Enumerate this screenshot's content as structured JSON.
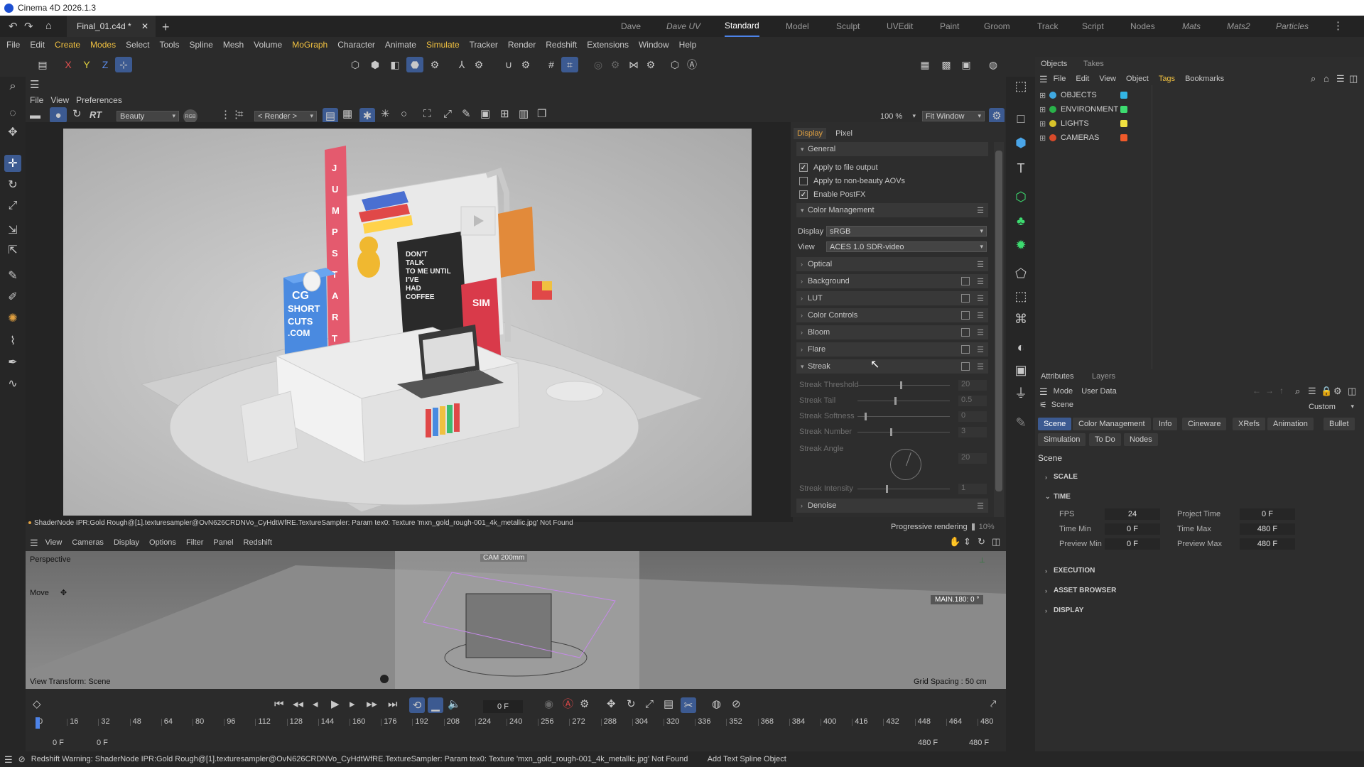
{
  "window": {
    "title": "Cinema 4D 2026.1.3"
  },
  "tabbar": {
    "doc_tab": "Final_01.c4d *",
    "layouts": [
      "Dave",
      "Dave UV",
      "Standard",
      "Model",
      "Sculpt",
      "UVEdit",
      "Paint",
      "Groom",
      "Track",
      "Script",
      "Nodes",
      "Mats",
      "Mats2",
      "Particles"
    ],
    "active_layout": "Standard"
  },
  "menubar": {
    "items": [
      "File",
      "Edit",
      "Create",
      "Modes",
      "Select",
      "Tools",
      "Spline",
      "Mesh",
      "Volume",
      "MoGraph",
      "Character",
      "Animate",
      "Simulate",
      "Tracker",
      "Render",
      "Redshift",
      "Extensions",
      "Window",
      "Help"
    ]
  },
  "toolbar": {
    "axis_x": "X",
    "axis_y": "Y",
    "axis_z": "Z"
  },
  "viewport": {
    "menu": [
      "File",
      "View",
      "Preferences"
    ],
    "aov": "Beauty",
    "rgb": "RGB",
    "render_mode": "< Render >",
    "rt": "RT",
    "zoom": "100 %",
    "fit": "Fit Window",
    "warning": "ShaderNode IPR:Gold Rough@[1].texturesampler@OvN626CRDNVo_CyHdtWfRE.TextureSampler: Param tex0: Texture 'mxn_gold_rough-001_4k_metallic.jpg' Not Found",
    "progressive_label": "Progressive rendering",
    "progress_pct": "10%",
    "progress": 0.1
  },
  "render_scene": {
    "sign_letters": [
      "J",
      "U",
      "M",
      "P",
      "S",
      "T",
      "A",
      "R",
      "T"
    ],
    "box_text": [
      "CG",
      "SHORT",
      "CUTS",
      ".COM"
    ],
    "poster_text": [
      "DON'T",
      "TALK",
      "TO ME UNTIL",
      "I'VE",
      "HAD",
      "COFFEE"
    ],
    "sim_text": "SIM"
  },
  "settings": {
    "tabs": [
      "Display",
      "Pixel"
    ],
    "sections": {
      "general": "General",
      "apply_file": "Apply to file output",
      "apply_aov": "Apply to non-beauty AOVs",
      "enable_postfx": "Enable PostFX",
      "color_mgmt": "Color Management",
      "display_label": "Display",
      "display_value": "sRGB",
      "view_label": "View",
      "view_value": "ACES 1.0 SDR-video",
      "optical": "Optical",
      "background": "Background",
      "lut": "LUT",
      "color_controls": "Color Controls",
      "bloom": "Bloom",
      "flare": "Flare",
      "streak": "Streak",
      "denoise": "Denoise"
    },
    "streak": {
      "threshold_label": "Streak Threshold",
      "threshold": "20",
      "tail_label": "Streak Tail",
      "tail": "0.5",
      "softness_label": "Streak Softness",
      "softness": "0",
      "number_label": "Streak Number",
      "number": "3",
      "angle_label": "Streak Angle",
      "angle": "20",
      "intensity_label": "Streak Intensity",
      "intensity": "1"
    }
  },
  "lower_viewport": {
    "menu": [
      "View",
      "Cameras",
      "Display",
      "Options",
      "Filter",
      "Panel",
      "Redshift"
    ],
    "label": "Perspective",
    "move": "Move",
    "cam": "CAM 200mm",
    "main": "MAIN.180:  0 °",
    "view_transform": "View Transform: Scene",
    "grid": "Grid Spacing : 50 cm"
  },
  "timeline": {
    "frame": "0 F",
    "ticks": [
      "0",
      "16",
      "32",
      "48",
      "64",
      "80",
      "96",
      "112",
      "128",
      "144",
      "160",
      "176",
      "192",
      "208",
      "224",
      "240",
      "256",
      "272",
      "288",
      "304",
      "320",
      "336",
      "352",
      "368",
      "384",
      "400",
      "416",
      "432",
      "448",
      "464",
      "480"
    ],
    "start": "0 F",
    "start2": "0 F",
    "end": "480 F",
    "end2": "480 F"
  },
  "objects": {
    "tabs": [
      "Objects",
      "Takes"
    ],
    "menu": [
      "File",
      "Edit",
      "View",
      "Object",
      "Tags",
      "Bookmarks"
    ],
    "rows": [
      {
        "name": "OBJECTS",
        "color": "#3fa8e0",
        "tag": "#33b5e5"
      },
      {
        "name": "ENVIRONMENT",
        "color": "#29b24a",
        "tag": "#3ddc70"
      },
      {
        "name": "LIGHTS",
        "color": "#d8c32a",
        "tag": "#f0e040"
      },
      {
        "name": "CAMERAS",
        "color": "#d84a2a",
        "tag": "#f05a2a"
      }
    ]
  },
  "attributes": {
    "tabs": [
      "Attributes",
      "Layers"
    ],
    "mode": "Mode",
    "user_data": "User Data",
    "scene_crumb": "Scene",
    "custom": "Custom",
    "subtabs1": [
      "Scene",
      "Color Management",
      "Info",
      "Cineware",
      "XRefs",
      "Animation",
      "Bullet"
    ],
    "subtabs2": [
      "Simulation",
      "To Do",
      "Nodes"
    ],
    "heading": "Scene",
    "groups": [
      "SCALE",
      "TIME",
      "EXECUTION",
      "ASSET BROWSER",
      "DISPLAY"
    ],
    "fps_label": "FPS",
    "fps": "24",
    "project_time_label": "Project Time",
    "project_time": "0 F",
    "time_min_label": "Time Min",
    "time_min": "0 F",
    "time_max_label": "Time Max",
    "time_max": "480 F",
    "preview_min_label": "Preview Min",
    "preview_min": "0 F",
    "preview_max_label": "Preview Max",
    "preview_max": "480 F"
  },
  "statusbar": {
    "warning": "Redshift Warning: ShaderNode IPR:Gold Rough@[1].texturesampler@OvN626CRDNVo_CyHdtWfRE.TextureSampler: Param tex0: Texture 'mxn_gold_rough-001_4k_metallic.jpg' Not Found",
    "hint": "Add Text Spline Object"
  }
}
